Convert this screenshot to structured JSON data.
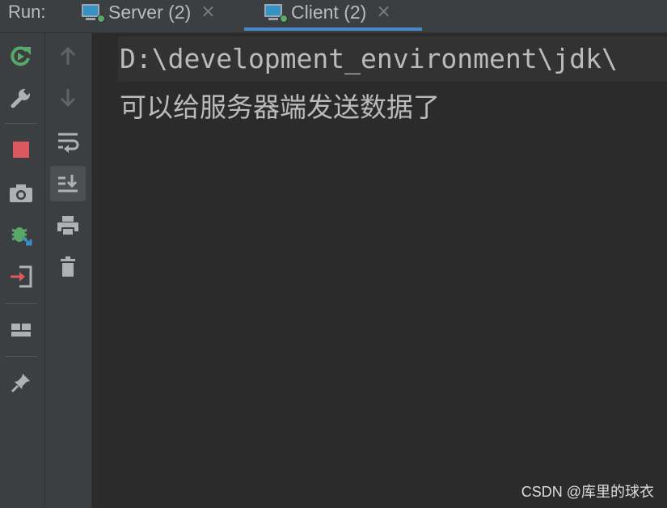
{
  "header": {
    "run_label": "Run:",
    "tabs": [
      {
        "label": "Server (2)",
        "active": false
      },
      {
        "label": "Client (2)",
        "active": true
      }
    ],
    "close_glyph": "×"
  },
  "toolbar_left": {
    "icons": [
      "rerun-icon",
      "wrench-icon",
      "stop-icon",
      "camera-icon",
      "debug-icon",
      "exit-icon",
      "layout-icon",
      "pin-icon"
    ]
  },
  "toolbar_right": {
    "icons": [
      "arrow-up-icon",
      "arrow-down-icon",
      "soft-wrap-icon",
      "scroll-to-end-icon",
      "print-icon",
      "trash-icon"
    ]
  },
  "console": {
    "lines": [
      "D:\\development_environment\\jdk\\",
      "可以给服务器端发送数据了"
    ]
  },
  "watermark": "CSDN @库里的球衣",
  "colors": {
    "accent": "#4a88c7",
    "rerun": "#59a869",
    "stop": "#db5860"
  }
}
